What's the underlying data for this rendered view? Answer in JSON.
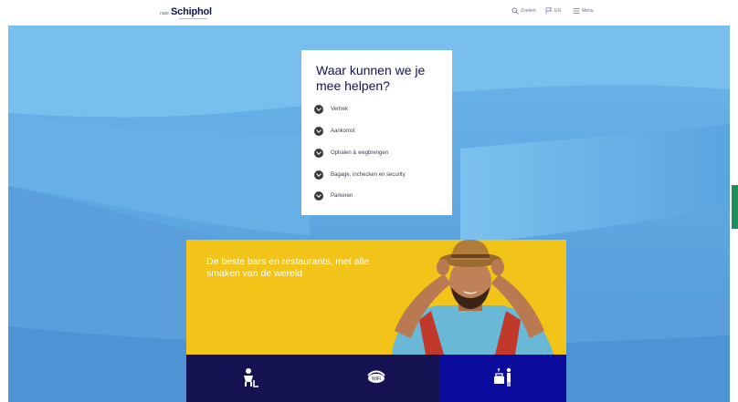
{
  "header": {
    "brand_prefix": "naar",
    "brand_name": "Schiphol",
    "nav": [
      {
        "label": "Zoeken",
        "icon": "search-icon"
      },
      {
        "label": "EN",
        "icon": "flag-icon"
      },
      {
        "label": "Menu",
        "icon": "menu-icon"
      }
    ]
  },
  "help": {
    "title": "Waar kunnen we je mee helpen?",
    "items": [
      {
        "label": "Vertrek"
      },
      {
        "label": "Aankomst"
      },
      {
        "label": "Ophalen & wegbrengen"
      },
      {
        "label": "Bagage, inchecken en security"
      },
      {
        "label": "Parkeren"
      }
    ]
  },
  "promo": {
    "text": "De beste bars en restaurants, met alle smaken van de wereld"
  },
  "tiles": [
    {
      "icon": "assistance-icon"
    },
    {
      "icon": "wifi-icon"
    },
    {
      "icon": "baggage-check-icon"
    }
  ],
  "colors": {
    "navy": "#141251",
    "sky": "#5ea6e0",
    "yellow": "#f2c318",
    "tile_dark": "#141251",
    "tile_blue": "#0c0c9c"
  }
}
